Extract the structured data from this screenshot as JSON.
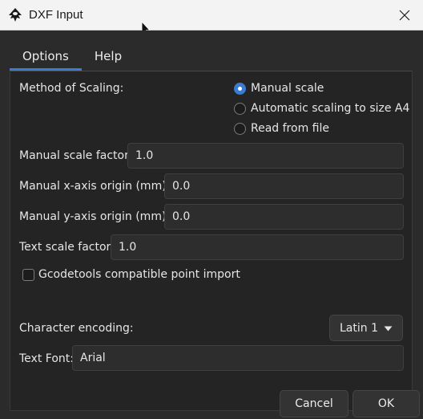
{
  "window": {
    "title": "DXF Input",
    "close_icon": "close-icon",
    "app_icon": "inkscape-logo-icon"
  },
  "tabs": [
    {
      "label": "Options",
      "active": true
    },
    {
      "label": "Help",
      "active": false
    }
  ],
  "options": {
    "scaling_method": {
      "label": "Method of Scaling:",
      "choices": [
        {
          "label": "Manual scale",
          "checked": true
        },
        {
          "label": "Automatic scaling to size A4",
          "checked": false
        },
        {
          "label": "Read from file",
          "checked": false
        }
      ]
    },
    "manual_scale_factor": {
      "label": "Manual scale factor:",
      "value": "1.0"
    },
    "x_origin": {
      "label": "Manual x-axis origin (mm):",
      "value": "0.0"
    },
    "y_origin": {
      "label": "Manual y-axis origin (mm):",
      "value": "0.0"
    },
    "text_scale_factor": {
      "label": "Text scale factor:",
      "value": "1.0"
    },
    "gcodetools": {
      "label": "Gcodetools compatible point import",
      "checked": false
    },
    "character_encoding": {
      "label": "Character encoding:",
      "value": "Latin 1"
    },
    "text_font": {
      "label": "Text Font:",
      "value": "Arial"
    }
  },
  "footer": {
    "cancel_label": "Cancel",
    "ok_label": "OK"
  },
  "colors": {
    "accent": "#3a7bd5",
    "background": "#2b2b2b",
    "titlebar": "#f3f3f3"
  }
}
